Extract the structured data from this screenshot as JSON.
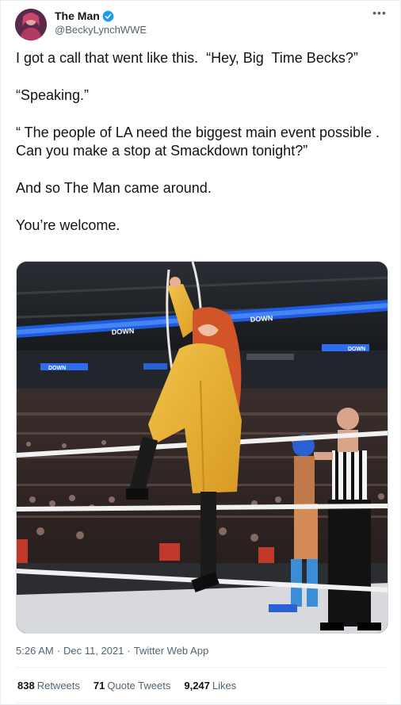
{
  "author": {
    "name": "The Man",
    "handle": "@BeckyLynchWWE",
    "verified_color": "#1d9bf0",
    "avatar_icon": "profile-photo"
  },
  "tweet": {
    "lines": [
      "I got a call that went like this.  “Hey, Big  Time Becks?”",
      "“Speaking.”",
      "“ The people of LA need the biggest main event possible . Can you make a stop at Smackdown tonight?”",
      "And so The Man came around.",
      "You’re welcome."
    ]
  },
  "media": {
    "banner_texts": [
      "DOWN",
      "DOWN",
      "DOWN",
      "DOWN"
    ]
  },
  "meta": {
    "time": "5:26 AM",
    "sep1": "·",
    "date": "Dec 11, 2021",
    "sep2": "·",
    "source": "Twitter Web App"
  },
  "stats": {
    "retweets_count": "838",
    "retweets_label": "Retweets",
    "quotes_count": "71",
    "quotes_label": "Quote Tweets",
    "likes_count": "9,247",
    "likes_label": "Likes"
  },
  "colors": {
    "text": "#0f1419",
    "secondary": "#536471",
    "accent": "#1d9bf0"
  }
}
